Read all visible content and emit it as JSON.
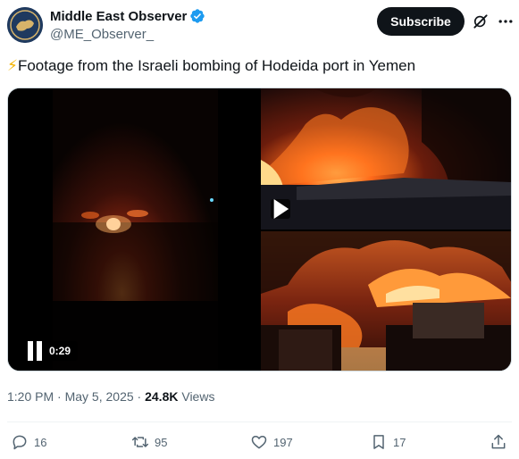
{
  "author": {
    "name": "Middle East Observer",
    "handle": "@ME_Observer_"
  },
  "subscribe_label": "Subscribe",
  "tweet": {
    "emoji": "⚡",
    "text": "Footage from the Israeli bombing of Hodeida port in Yemen"
  },
  "media": {
    "video_duration": "0:29"
  },
  "meta": {
    "time": "1:20 PM",
    "separator1": " · ",
    "date": "May 5, 2025",
    "separator2": " · ",
    "views_count": "24.8K",
    "views_label": " Views"
  },
  "actions": {
    "replies": "16",
    "reposts": "95",
    "likes": "197",
    "bookmarks": "17"
  },
  "colors": {
    "verified": "#1d9bf0",
    "text_secondary": "#536471",
    "button_bg": "#0f1419"
  },
  "icons": [
    "verified-badge-icon",
    "grok-icon",
    "more-icon",
    "pause-icon",
    "play-icon",
    "reply-icon",
    "repost-icon",
    "like-icon",
    "bookmark-icon",
    "share-icon"
  ]
}
